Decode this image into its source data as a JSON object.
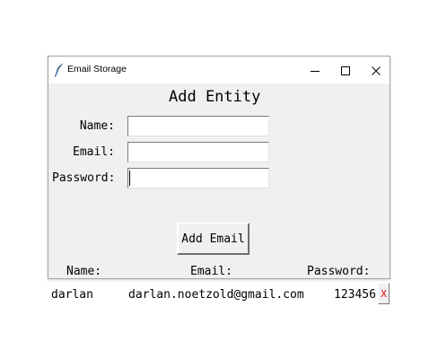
{
  "window": {
    "title": "Email Storage",
    "icon": "feather-icon",
    "controls": [
      "minimize-icon",
      "maximize-icon",
      "close-icon"
    ]
  },
  "form": {
    "heading": "Add Entity",
    "name_label": "Name:",
    "email_label": "Email:",
    "password_label": "Password:",
    "name_value": "",
    "email_value": "",
    "password_value": "",
    "submit_label": "Add Email"
  },
  "list": {
    "headers": {
      "name": "Name:",
      "email": "Email:",
      "password": "Password:"
    },
    "rows": [
      {
        "name": "darlan",
        "email": "darlan.noetzold@gmail.com",
        "password": "123456",
        "delete_label": "X"
      }
    ]
  },
  "colors": {
    "window_bg": "#f0f0f0",
    "titlebar_bg": "#ffffff",
    "delete_text": "#e00000"
  }
}
